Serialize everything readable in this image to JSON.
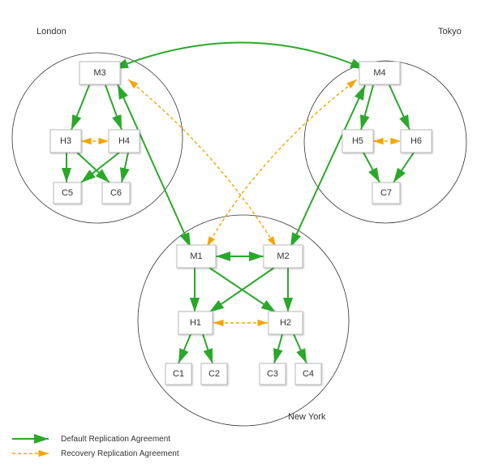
{
  "regions": {
    "london": {
      "label": "London"
    },
    "tokyo": {
      "label": "Tokyo"
    },
    "newyork": {
      "label": "New York"
    }
  },
  "nodes": {
    "M1": "M1",
    "M2": "M2",
    "M3": "M3",
    "M4": "M4",
    "H1": "H1",
    "H2": "H2",
    "H3": "H3",
    "H4": "H4",
    "H5": "H5",
    "H6": "H6",
    "C1": "C1",
    "C2": "C2",
    "C3": "C3",
    "C4": "C4",
    "C5": "C5",
    "C6": "C6",
    "C7": "C7"
  },
  "legend": {
    "default": "Default Replication Agreement",
    "recovery": "Recovery  Replication Agreement"
  },
  "colors": {
    "default_edge": "#2aa82a",
    "recovery_edge": "#f5a500",
    "node_border": "#bbbbbb",
    "text": "#333333"
  },
  "chart_data": {
    "type": "table",
    "title": "Replication Topology",
    "regions": [
      {
        "name": "London",
        "masters": [
          "M3"
        ],
        "hubs": [
          "H3",
          "H4"
        ],
        "clients": [
          "C5",
          "C6"
        ]
      },
      {
        "name": "Tokyo",
        "masters": [
          "M4"
        ],
        "hubs": [
          "H5",
          "H6"
        ],
        "clients": [
          "C7"
        ]
      },
      {
        "name": "New York",
        "masters": [
          "M1",
          "M2"
        ],
        "hubs": [
          "H1",
          "H2"
        ],
        "clients": [
          "C1",
          "C2",
          "C3",
          "C4"
        ]
      }
    ],
    "default_replication_agreements": [
      [
        "M3",
        "M4"
      ],
      [
        "M3",
        "M1"
      ],
      [
        "M4",
        "M2"
      ],
      [
        "M1",
        "M2"
      ],
      [
        "M3",
        "H3"
      ],
      [
        "M3",
        "H4"
      ],
      [
        "M4",
        "H5"
      ],
      [
        "M4",
        "H6"
      ],
      [
        "M1",
        "H1"
      ],
      [
        "M1",
        "H2"
      ],
      [
        "M2",
        "H1"
      ],
      [
        "M2",
        "H2"
      ],
      [
        "H3",
        "C5"
      ],
      [
        "H3",
        "C6"
      ],
      [
        "H4",
        "C5"
      ],
      [
        "H4",
        "C6"
      ],
      [
        "H5",
        "C7"
      ],
      [
        "H6",
        "C7"
      ],
      [
        "H1",
        "C1"
      ],
      [
        "H1",
        "C2"
      ],
      [
        "H2",
        "C3"
      ],
      [
        "H2",
        "C4"
      ]
    ],
    "recovery_replication_agreements": [
      [
        "H3",
        "H4"
      ],
      [
        "H5",
        "H6"
      ],
      [
        "H1",
        "H2"
      ],
      [
        "M3",
        "M2"
      ],
      [
        "M4",
        "M1"
      ]
    ]
  }
}
